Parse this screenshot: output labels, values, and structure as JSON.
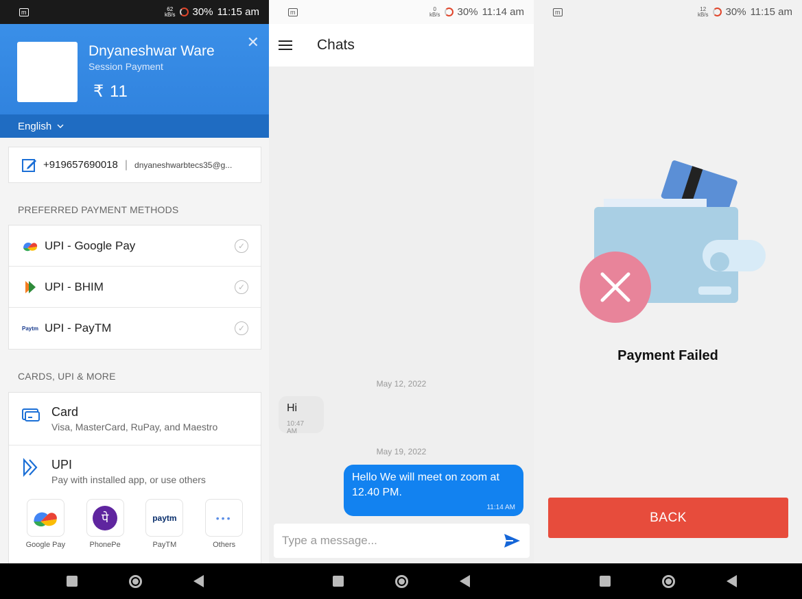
{
  "status_bars": [
    {
      "net_rate": "62",
      "net_unit": "kB/s",
      "battery": "30%",
      "time": "11:15 am"
    },
    {
      "net_rate": "0",
      "net_unit": "kB/s",
      "battery": "30%",
      "time": "11:14 am"
    },
    {
      "net_rate": "12",
      "net_unit": "kB/s",
      "battery": "30%",
      "time": "11:15 am"
    }
  ],
  "status_app_icon": "m",
  "payment": {
    "merchant_name": "Dnyaneshwar Ware",
    "subtitle": "Session Payment",
    "amount": "₹ 11",
    "close_icon": "✕",
    "language": "English",
    "phone": "+919657690018",
    "separator": "|",
    "email": "dnyaneshwarbtecs35@g...",
    "preferred_title": "PREFERRED PAYMENT METHODS",
    "preferred_methods": [
      {
        "label": "UPI - Google Pay",
        "icon": "google-pay-icon"
      },
      {
        "label": "UPI - BHIM",
        "icon": "bhim-icon"
      },
      {
        "label": "UPI - PayTM",
        "icon": "paytm-icon",
        "icon_text": "Paytm"
      }
    ],
    "check_glyph": "✓",
    "cards_title": "CARDS, UPI & MORE",
    "card_option": {
      "title": "Card",
      "subtitle": "Visa, MasterCard, RuPay, and Maestro"
    },
    "upi_option": {
      "title": "UPI",
      "subtitle": "Pay with installed app, or use others"
    },
    "upi_apps": [
      {
        "label": "Google Pay",
        "icon": "google-pay-icon"
      },
      {
        "label": "PhonePe",
        "icon": "phonepe-icon",
        "glyph": "पे"
      },
      {
        "label": "PayTM",
        "icon": "paytm-icon",
        "glyph": "paytm"
      },
      {
        "label": "Others",
        "icon": "more-dots-icon",
        "glyph": "•••"
      }
    ],
    "accent": "#2e80dc"
  },
  "chat": {
    "title": "Chats",
    "dates": [
      "May 12, 2022",
      "May 19, 2022"
    ],
    "incoming": {
      "text": "Hi",
      "time": "10:47 AM"
    },
    "outgoing": {
      "text": "Hello We will meet on zoom at 12.40 PM.",
      "time": "11:14 AM"
    },
    "input_placeholder": "Type a message...",
    "accent": "#1282f0"
  },
  "result": {
    "message": "Payment Failed",
    "back_label": "BACK",
    "button_color": "#e74c3c"
  }
}
